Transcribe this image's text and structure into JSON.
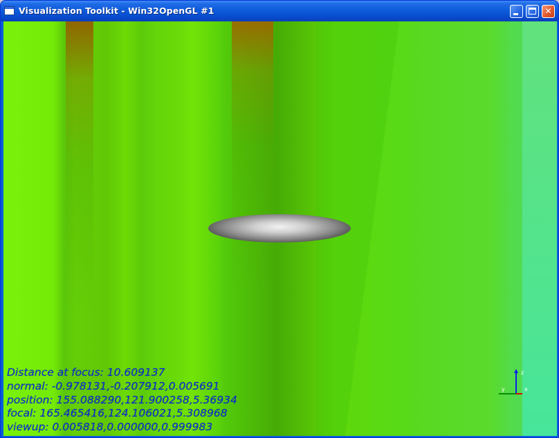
{
  "window": {
    "title": "Visualization Toolkit - Win32OpenGL #1",
    "icon": "vtk-window-icon",
    "controls": {
      "minimize": "minimize-icon",
      "maximize": "maximize-icon",
      "close": "close-icon",
      "close_glyph": "✕"
    }
  },
  "scene": {
    "object": "ellipsoid",
    "background_colors": [
      "#79f20a",
      "#5cc90a",
      "#45e39a"
    ]
  },
  "camera_info": {
    "distance": "Distance at focus: 10.609137",
    "normal": "normal: -0.978131,-0.207912,0.005691",
    "position": "position: 155.088290,121.900258,5.36934",
    "focal": "focal: 165.465416,124.106021,5.308968",
    "viewup": "viewup: 0.005818,0.000000,0.999983"
  },
  "orientation_axes": {
    "z_label": "z",
    "y_label": "y",
    "x_label": "x"
  }
}
